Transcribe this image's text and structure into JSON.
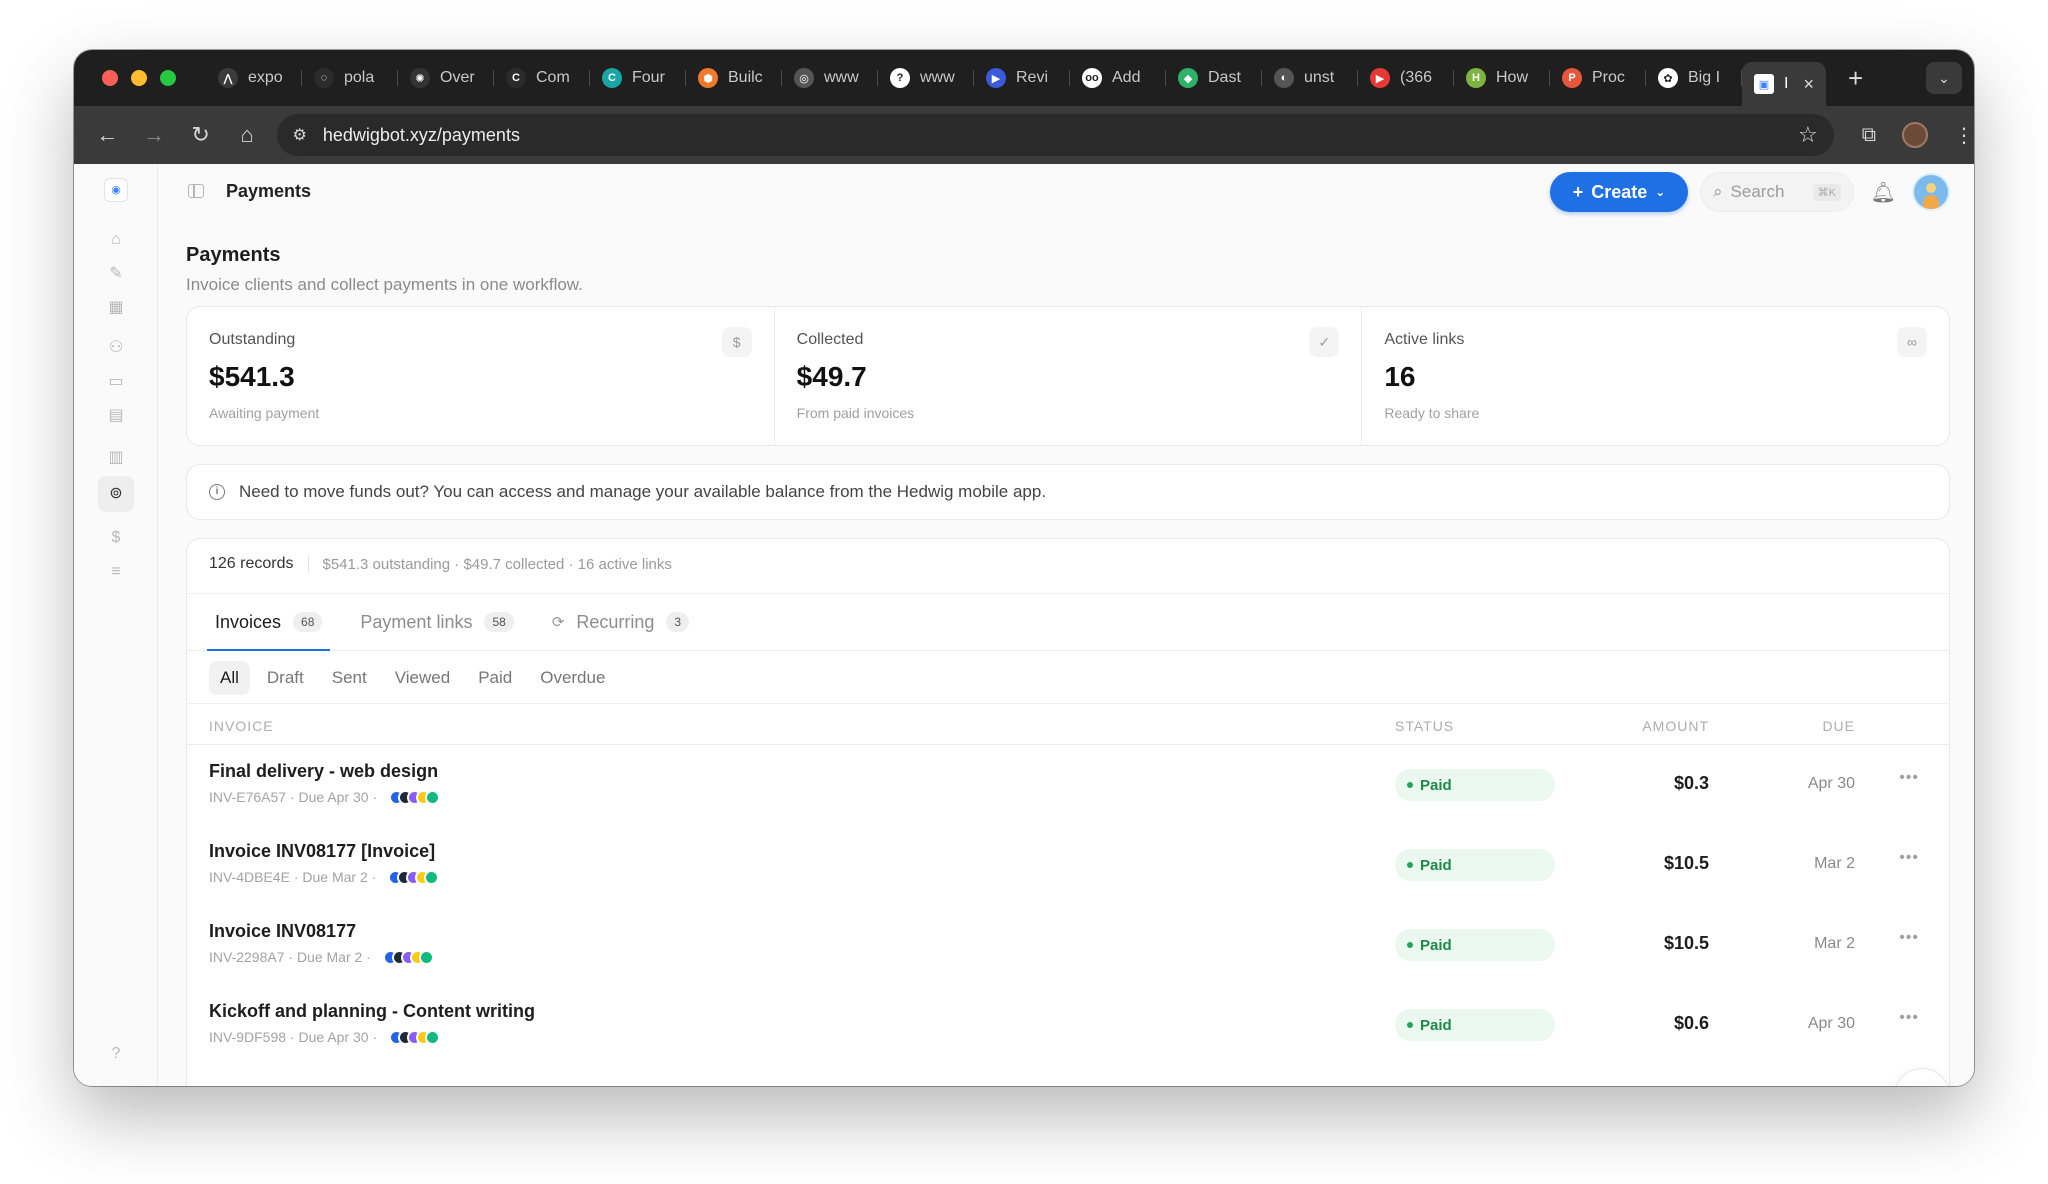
{
  "browser": {
    "tabs": [
      {
        "label": "expo",
        "fav_color": "#3a3a3a",
        "fav_glyph": "⋀"
      },
      {
        "label": "pola",
        "fav_color": "#2b2b2b",
        "fav_glyph": "◌"
      },
      {
        "label": "Over",
        "fav_color": "#333333",
        "fav_glyph": "✺"
      },
      {
        "label": "Com",
        "fav_color": "#2b2b2b",
        "fav_glyph": "C"
      },
      {
        "label": "Four",
        "fav_color": "#1aa6a6",
        "fav_glyph": "C"
      },
      {
        "label": "Builc",
        "fav_color": "#f07a2b",
        "fav_glyph": "⬢"
      },
      {
        "label": "www",
        "fav_color": "#555555",
        "fav_glyph": "◎"
      },
      {
        "label": "www",
        "fav_color": "#ffffff",
        "fav_glyph": "?"
      },
      {
        "label": "Revi",
        "fav_color": "#3b5bdb",
        "fav_glyph": "▶"
      },
      {
        "label": "Add",
        "fav_color": "#ffffff",
        "fav_glyph": "oo"
      },
      {
        "label": "Dast",
        "fav_color": "#2fb36a",
        "fav_glyph": "◆"
      },
      {
        "label": "unst",
        "fav_color": "#555555",
        "fav_glyph": "◐"
      },
      {
        "label": "(366",
        "fav_color": "#e53935",
        "fav_glyph": "▶"
      },
      {
        "label": "How",
        "fav_color": "#7cb342",
        "fav_glyph": "H"
      },
      {
        "label": "Proc",
        "fav_color": "#e8553d",
        "fav_glyph": "P"
      },
      {
        "label": "Big I",
        "fav_color": "#ffffff",
        "fav_glyph": "✿"
      }
    ],
    "active_tab": {
      "label": "I",
      "fav_glyph": "▣"
    },
    "url": "hedwigbot.xyz/payments"
  },
  "topbar": {
    "title": "Payments",
    "create_label": "Create",
    "search_placeholder": "Search",
    "search_shortcut": "⌘K"
  },
  "page": {
    "title": "Payments",
    "subtitle": "Invoice clients and collect payments in one workflow."
  },
  "stats": [
    {
      "label": "Outstanding",
      "value": "$541.3",
      "note": "Awaiting payment",
      "icon": "dollar-icon",
      "glyph": "$"
    },
    {
      "label": "Collected",
      "value": "$49.7",
      "note": "From paid invoices",
      "icon": "check-circle-icon",
      "glyph": "✓"
    },
    {
      "label": "Active links",
      "value": "16",
      "note": "Ready to share",
      "icon": "link-icon",
      "glyph": "∞"
    }
  ],
  "info": {
    "text": "Need to move funds out? You can access and manage your available balance from the Hedwig mobile app."
  },
  "records": {
    "count": "126 records",
    "summary": "$541.3 outstanding · $49.7 collected · 16 active links",
    "tabs": [
      {
        "label": "Invoices",
        "count": "68"
      },
      {
        "label": "Payment links",
        "count": "58"
      },
      {
        "label": "Recurring",
        "count": "3"
      }
    ],
    "filters": [
      "All",
      "Draft",
      "Sent",
      "Viewed",
      "Paid",
      "Overdue"
    ],
    "columns": {
      "invoice": "INVOICE",
      "status": "STATUS",
      "amount": "AMOUNT",
      "due": "DUE"
    },
    "rows": [
      {
        "title": "Final delivery - web design",
        "meta": "INV-E76A57 · Due Apr 30 ·",
        "status": "Paid",
        "amount": "$0.3",
        "due": "Apr 30"
      },
      {
        "title": "Invoice INV08177 [Invoice]",
        "meta": "INV-4DBE4E · Due Mar 2 ·",
        "status": "Paid",
        "amount": "$10.5",
        "due": "Mar 2"
      },
      {
        "title": "Invoice INV08177",
        "meta": "INV-2298A7 · Due Mar 2 ·",
        "status": "Paid",
        "amount": "$10.5",
        "due": "Mar 2"
      },
      {
        "title": "Kickoff and planning - Content writing",
        "meta": "INV-9DF598 · Due Apr 30 ·",
        "status": "Paid",
        "amount": "$0.6",
        "due": "Apr 30"
      }
    ],
    "chip_colors": [
      "#2563eb",
      "#1f2937",
      "#8b5cf6",
      "#facc15",
      "#10b981"
    ]
  },
  "colors": {
    "accent": "#1f6fe5",
    "paid_bg": "#eaf8ef",
    "paid_text": "#1d8a4a"
  }
}
